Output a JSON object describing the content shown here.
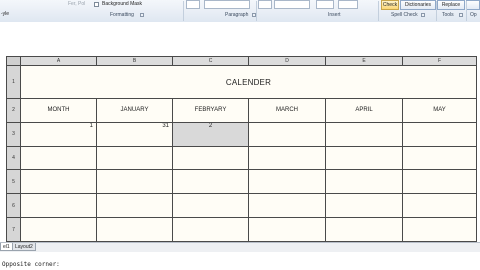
{
  "ribbon": {
    "top_left_text": "-yle",
    "faded_text": "Fer, Pol",
    "background_mask_label": "Background Mask",
    "groups": [
      "Formatting",
      "Paragraph",
      "Insert",
      "Spell Check",
      "Tools",
      "Op"
    ],
    "buttons": {
      "check": "Check",
      "dictionaries": "Dictionaries",
      "replace": "Replace"
    }
  },
  "spreadsheet": {
    "column_headers": [
      "A",
      "B",
      "C",
      "D",
      "E",
      "F"
    ],
    "row_headers": [
      "1",
      "2",
      "3",
      "4",
      "5",
      "6",
      "7"
    ],
    "title": "CALENDER",
    "months": [
      "MONTH",
      "JANUARY",
      "FEBRYARY",
      "MARCH",
      "APRIL",
      "MAY"
    ],
    "row3": [
      "1",
      "31",
      "2",
      "",
      "",
      ""
    ]
  },
  "layout_tabs": [
    "el1",
    "Layout2"
  ],
  "command_line": {
    "text": "Opposite corner:"
  }
}
